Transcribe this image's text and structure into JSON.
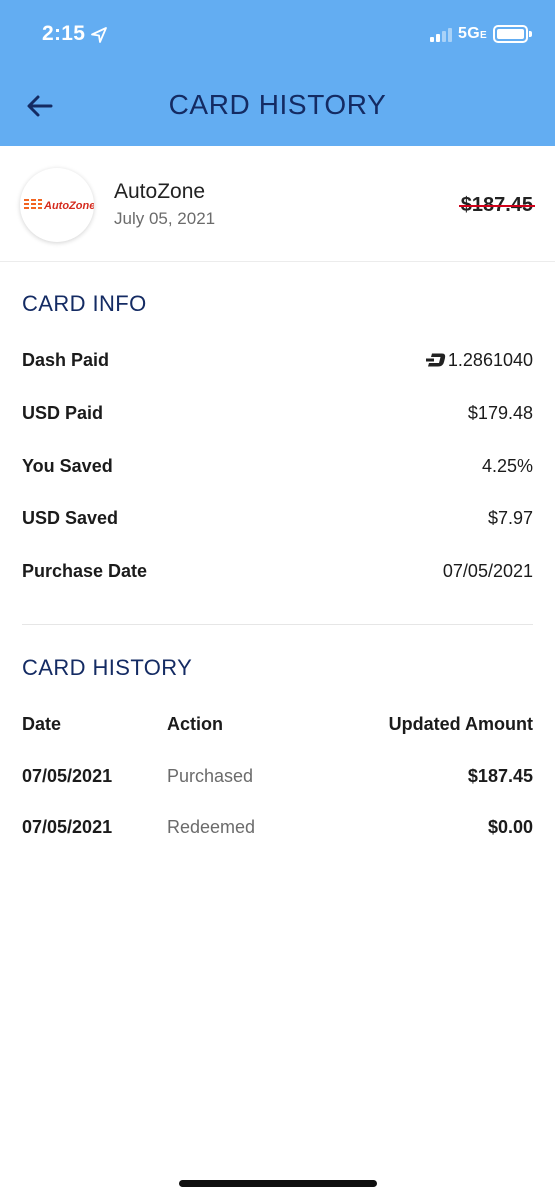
{
  "status_bar": {
    "time": "2:15",
    "network": "5G",
    "network_suffix": "E"
  },
  "header": {
    "title": "CARD HISTORY"
  },
  "merchant": {
    "name": "AutoZone",
    "date": "July 05, 2021",
    "amount": "$187.45",
    "logo_text": "AutoZone",
    "logo_color": "#d52b1e",
    "logo_stripe_color": "#f26522"
  },
  "card_info": {
    "title": "CARD INFO",
    "rows": [
      {
        "label": "Dash Paid",
        "value": "1.2861040"
      },
      {
        "label": "USD Paid",
        "value": "$179.48"
      },
      {
        "label": "You Saved",
        "value": "4.25%"
      },
      {
        "label": "USD Saved",
        "value": "$7.97"
      },
      {
        "label": "Purchase Date",
        "value": "07/05/2021"
      }
    ]
  },
  "card_history": {
    "title": "CARD HISTORY",
    "headers": {
      "date": "Date",
      "action": "Action",
      "amount": "Updated Amount"
    },
    "rows": [
      {
        "date": "07/05/2021",
        "action": "Purchased",
        "amount": "$187.45"
      },
      {
        "date": "07/05/2021",
        "action": "Redeemed",
        "amount": "$0.00"
      }
    ]
  },
  "colors": {
    "header_bg": "#63adf2",
    "title_navy": "#142b63",
    "strike_red": "#d0021b"
  }
}
